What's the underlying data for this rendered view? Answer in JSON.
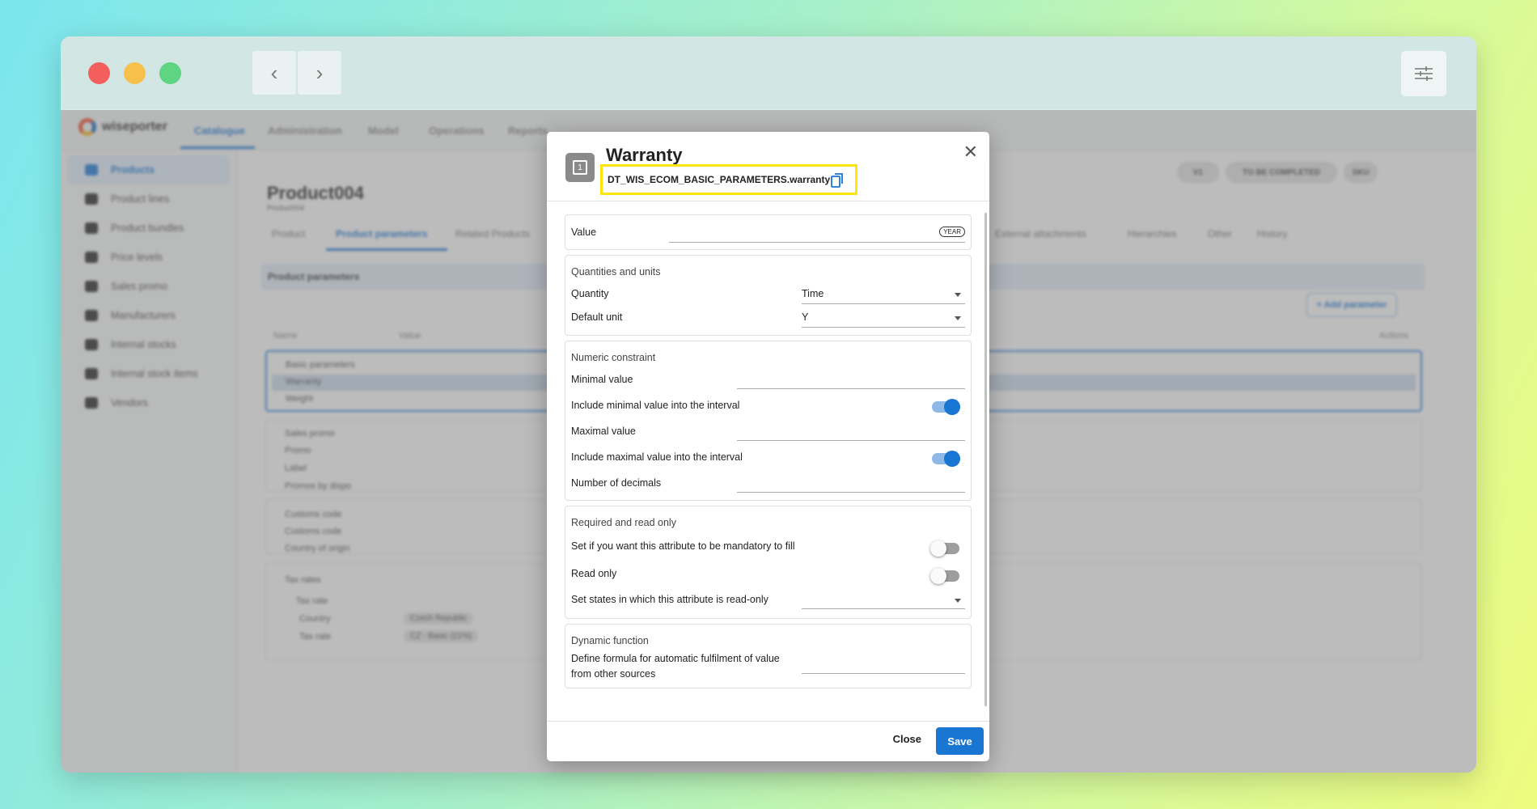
{
  "app": {
    "brand": "wiseporter",
    "nav": [
      "Catalogue",
      "Administration",
      "Model",
      "Operations",
      "Reports"
    ],
    "sidebar": [
      "Products",
      "Product lines",
      "Product bundles",
      "Price levels",
      "Sales promo",
      "Manufacturers",
      "Internal stocks",
      "Internal stock items",
      "Vendors"
    ],
    "product_title": "Product004",
    "product_sub": "Product004",
    "tabs": [
      "Product",
      "Product parameters",
      "Related Products",
      "External attachments",
      "Hierarchies",
      "Other",
      "History"
    ],
    "section_header": "Product parameters",
    "add_parameter": "+ Add parameter",
    "status_chips": [
      "V1",
      "TO BE COMPLETED",
      "SKU"
    ],
    "table_headers": {
      "name": "Name",
      "value": "Value",
      "actions": "Actions"
    },
    "groups": [
      {
        "title": "Basic parameters",
        "rows": [
          "Warranty",
          "Weight"
        ]
      },
      {
        "title": "Sales promo",
        "rows": [
          "Promo",
          "Label",
          "Promos by dispo"
        ]
      },
      {
        "title": "Customs code",
        "rows": [
          "Customs code",
          "Country of origin"
        ]
      },
      {
        "title": "Tax rates",
        "rows": [
          "Tax rate",
          "Country",
          "Tax rate"
        ]
      }
    ],
    "tax_values": [
      "Czech Republic",
      "CZ - Basic (21%)"
    ]
  },
  "modal": {
    "title": "Warranty",
    "code": "DT_WIS_ECOM_BASIC_PARAMETERS.warranty",
    "value_label": "Value",
    "value_unit": "YEAR",
    "quantities": {
      "title": "Quantities and units",
      "quantity_label": "Quantity",
      "quantity_value": "Time",
      "unit_label": "Default unit",
      "unit_value": "Y"
    },
    "numeric": {
      "title": "Numeric constraint",
      "min_label": "Minimal value",
      "include_min_label": "Include minimal value into the interval",
      "include_min": true,
      "max_label": "Maximal value",
      "include_max_label": "Include maximal value into the interval",
      "include_max": true,
      "decimals_label": "Number of decimals"
    },
    "required": {
      "title": "Required and read only",
      "mandatory_label": "Set if you want this attribute to be mandatory to fill",
      "mandatory": false,
      "readonly_label": "Read only",
      "readonly": false,
      "states_label": "Set states in which this attribute is read-only"
    },
    "dynamic": {
      "title": "Dynamic function",
      "formula_label_1": "Define formula for automatic fulfilment of value",
      "formula_label_2": "from other sources"
    },
    "close_label": "Close",
    "save_label": "Save"
  },
  "colors": {
    "accent": "#1976d2",
    "highlight": "#ffe40a"
  }
}
